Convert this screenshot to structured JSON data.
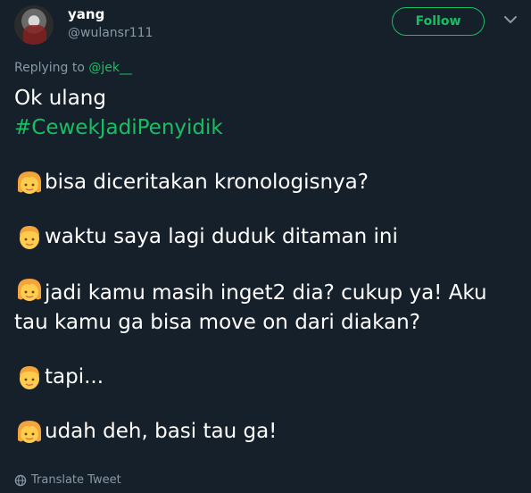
{
  "author": {
    "name": "yang",
    "handle": "@wulansr111",
    "avatar_icon": "user-avatar"
  },
  "follow_label": "Follow",
  "reply": {
    "prefix": "Replying to",
    "mention": "@jek__"
  },
  "tweet": {
    "line1": "Ok ulang",
    "hashtag": "#CewekJadiPenyidik",
    "lines": [
      {
        "speaker": "woman-emoji",
        "text": "bisa diceritakan kronologisnya?"
      },
      {
        "speaker": "boy-emoji",
        "text": "waktu saya lagi duduk ditaman ini"
      },
      {
        "speaker": "woman-emoji",
        "text": "jadi kamu masih inget2 dia? cukup ya! Aku tau kamu ga bisa move on dari diakan?"
      },
      {
        "speaker": "boy-emoji",
        "text": "tapi..."
      },
      {
        "speaker": "woman-emoji",
        "text": "udah deh, basi tau ga!"
      }
    ]
  },
  "translate_label": "Translate Tweet",
  "colors": {
    "background": "#15202b",
    "accent": "#17bf63",
    "muted": "#8899a6"
  }
}
